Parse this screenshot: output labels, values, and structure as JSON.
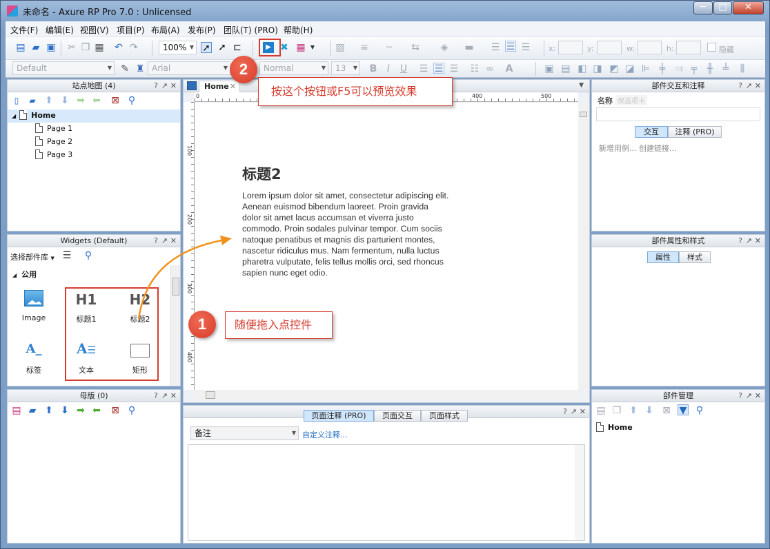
{
  "window": {
    "title": "未命名 - Axure RP Pro 7.0 : Unlicensed",
    "min": "─",
    "max": "□",
    "close": "✕"
  },
  "menu": [
    "文件(F)",
    "编辑(E)",
    "视图(V)",
    "项目(P)",
    "布局(A)",
    "发布(P)",
    "团队(T) (PRO)",
    "帮助(H)"
  ],
  "toolbar": {
    "zoom": "100%",
    "style_combo": "Default",
    "font_combo": "Arial",
    "weight_combo": "Normal",
    "size_combo": "13",
    "x_label": "x:",
    "y_label": "y:",
    "w_label": "w:",
    "h_label": "h:",
    "hidden_label": "隐藏"
  },
  "sitemap": {
    "title": "站点地图 (4)",
    "pages": [
      {
        "label": "Home"
      },
      {
        "label": "Page 1"
      },
      {
        "label": "Page 2"
      },
      {
        "label": "Page 3"
      }
    ]
  },
  "widgets": {
    "title": "Widgets (Default)",
    "library_label": "选择部件库",
    "category": "公用",
    "items": [
      {
        "label": "Image"
      },
      {
        "label": "标题1",
        "glyph": "H1"
      },
      {
        "label": "标题2",
        "glyph": "H2"
      },
      {
        "label": "标签",
        "glyph": "A_"
      },
      {
        "label": "文本"
      },
      {
        "label": "矩形"
      }
    ]
  },
  "masters": {
    "title": "母版 (0)"
  },
  "canvas": {
    "tab": "Home",
    "ruler_h": [
      "0",
      "100",
      "400",
      "500"
    ],
    "ruler_v": [
      "100",
      "200",
      "300",
      "400"
    ],
    "heading": "标题2",
    "paragraph": "Lorem ipsum dolor sit amet, consectetur adipiscing elit. Aenean euismod bibendum laoreet. Proin gravida dolor sit amet lacus accumsan et viverra justo commodo. Proin sodales pulvinar tempor. Cum sociis natoque penatibus et magnis dis parturient montes, nascetur ridiculus mus. Nam fermentum, nulla luctus pharetra vulputate, felis tellus mollis orci, sed rhoncus sapien nunc eget odio."
  },
  "page_notes": {
    "tabs": [
      "页面注释 (PRO)",
      "页面交互",
      "页面样式"
    ],
    "select_value": "备注",
    "custom_link": "自定义注释..."
  },
  "interactions": {
    "title": "部件交互和注释",
    "name_label": "名称",
    "ghost_tab": "保选项卡",
    "tabs": [
      "交互",
      "注释 (PRO)"
    ],
    "links": "新增用例... 创建链接..."
  },
  "properties": {
    "title": "部件属性和样式",
    "tabs": [
      "属性",
      "样式"
    ]
  },
  "manager": {
    "title": "部件管理",
    "item": "Home"
  },
  "callouts": {
    "one": {
      "number": "1",
      "text": "随便拖入点控件"
    },
    "two": {
      "number": "2",
      "text": "按这个按钮或F5可以预览效果"
    }
  },
  "colors": {
    "accent_red": "#d53b2d",
    "callout_arrow": "#f0931e"
  }
}
